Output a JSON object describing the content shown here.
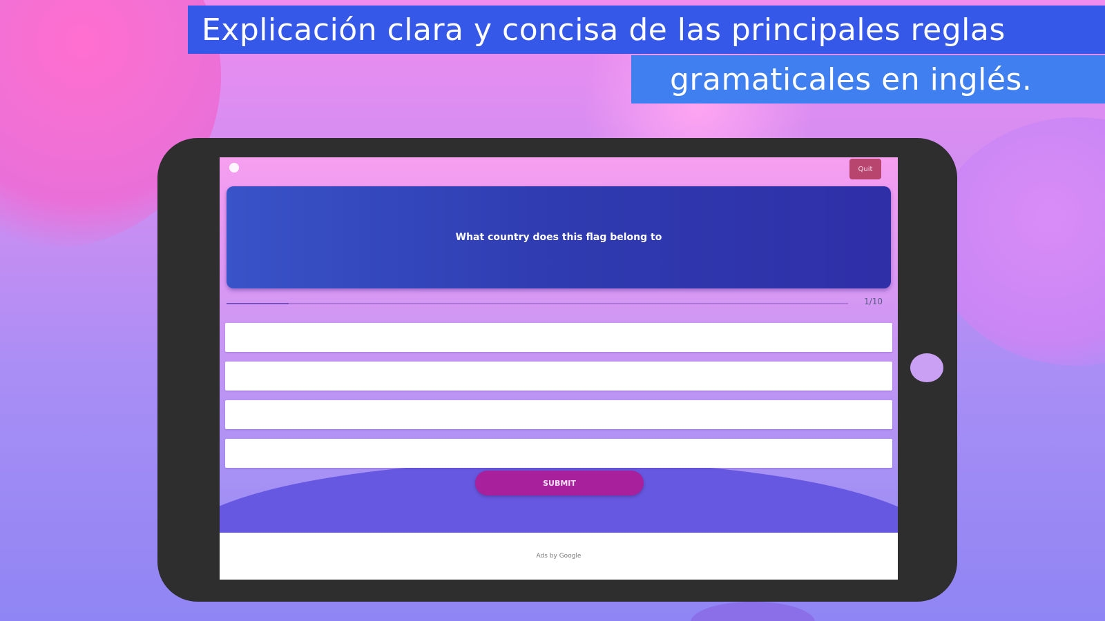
{
  "caption": {
    "line1": "Explicación clara y concisa  de las principales reglas",
    "line2": "gramaticales en inglés."
  },
  "app": {
    "quit_label": "Quit",
    "question": "What country does this flag belong to",
    "progress": {
      "current": 1,
      "total": 10,
      "label": "1/10"
    },
    "options": [
      "",
      "",
      "",
      ""
    ],
    "submit_label": "SUBMIT",
    "ad_label": "Ads by Google"
  },
  "icons": {
    "app_icon": "circle-icon",
    "home_button": "home-button"
  },
  "colors": {
    "caption_primary": "#3658e8",
    "caption_secondary": "#3f7ff0",
    "question_card": "#2f3bb0",
    "quit_button": "#b8456d",
    "submit_button": "#a8209b",
    "tablet_frame": "#2e2e2e"
  }
}
